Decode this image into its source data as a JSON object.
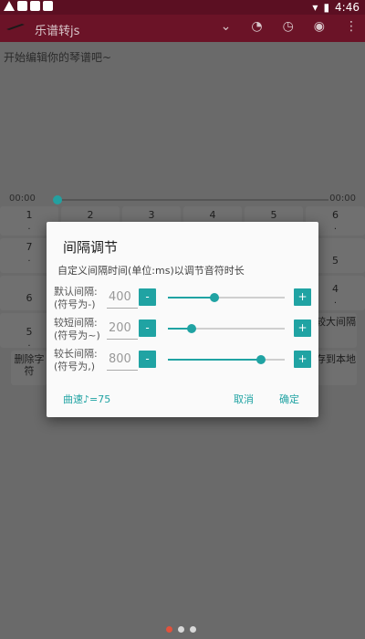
{
  "status_bar": {
    "time": "4:46"
  },
  "toolbar": {
    "title": "乐谱转js",
    "icons": [
      "chevron-down-icon",
      "speed-icon",
      "stopwatch-icon",
      "compass-icon",
      "more-vert-icon"
    ]
  },
  "editor": {
    "hint": "开始编辑你的琴谱吧~"
  },
  "timeline": {
    "start": "00:00",
    "end": "00:00",
    "position": 0
  },
  "keys": [
    {
      "label": "1",
      "sub": "."
    },
    {
      "label": "2",
      "sub": ""
    },
    {
      "label": "3",
      "sub": ""
    },
    {
      "label": "4",
      "sub": ""
    },
    {
      "label": "5",
      "sub": ""
    },
    {
      "label": "6",
      "sub": "."
    },
    {
      "label": "7",
      "sub": "."
    },
    {
      "label": "5",
      "sub": ""
    },
    {
      "label": "6",
      "sub": ""
    },
    {
      "label": "4",
      "sub": "."
    },
    {
      "label": "5",
      "sub": "."
    },
    {
      "label": "较大间隔",
      "sub": ""
    },
    {
      "label": "删除字符",
      "sub": ""
    },
    {
      "label": "存到本地",
      "sub": ""
    }
  ],
  "dialog": {
    "title": "间隔调节",
    "description": "自定义间隔时间(单位:ms)以调节音符时长",
    "rows": [
      {
        "label_line1": "默认间隔:",
        "label_line2": "(符号为-)",
        "value": "400",
        "slider_fraction": 0.4
      },
      {
        "label_line1": "较短间隔:",
        "label_line2": "(符号为~)",
        "value": "200",
        "slider_fraction": 0.2
      },
      {
        "label_line1": "较长间隔:",
        "label_line2": "(符号为,)",
        "value": "800",
        "slider_fraction": 0.8
      }
    ],
    "minus_label": "-",
    "plus_label": "+",
    "tempo": "曲速♪=75",
    "cancel": "取消",
    "ok": "确定"
  },
  "page_dots": {
    "count": 3,
    "active_index": 0
  },
  "colors": {
    "accent": "#20a3a3",
    "toolbar": "#6b1327",
    "statusbar": "#5b0f22",
    "active_dot": "#e2523c"
  }
}
